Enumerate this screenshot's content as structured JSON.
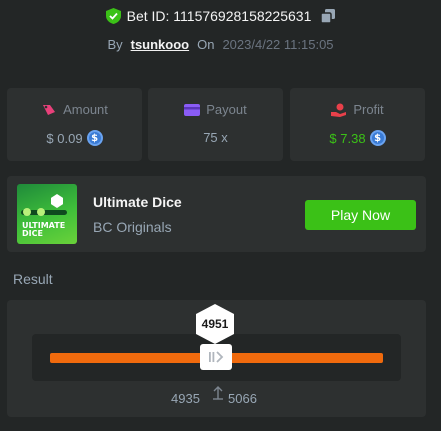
{
  "header": {
    "bet_id": "Bet ID: 111576928158225631",
    "by_label": "By",
    "username": "tsunkooo",
    "on_label": "On",
    "datetime": "2023/4/22 11:15:05"
  },
  "stats": {
    "amount": {
      "label": "Amount",
      "value": "$ 0.09",
      "icon": "amount-icon"
    },
    "payout": {
      "label": "Payout",
      "value": "75 x",
      "icon": "payout-icon"
    },
    "profit": {
      "label": "Profit",
      "value": "$ 7.38",
      "icon": "profit-icon"
    },
    "coin_symbol": "$"
  },
  "game": {
    "thumbnail_text": "ULTIMATE DICE",
    "name": "Ultimate Dice",
    "provider": "BC Originals",
    "play_label": "Play Now"
  },
  "result": {
    "label": "Result",
    "rolled": "4951",
    "range_low": "4935",
    "range_high": "5066"
  },
  "colors": {
    "background": "#232626",
    "panel": "#2d3030",
    "accent_green": "#3bc117",
    "track_orange": "#f06a0d",
    "amount_pink": "#e8407a",
    "payout_purple": "#8a5cf6",
    "profit_red": "#e8404a"
  }
}
